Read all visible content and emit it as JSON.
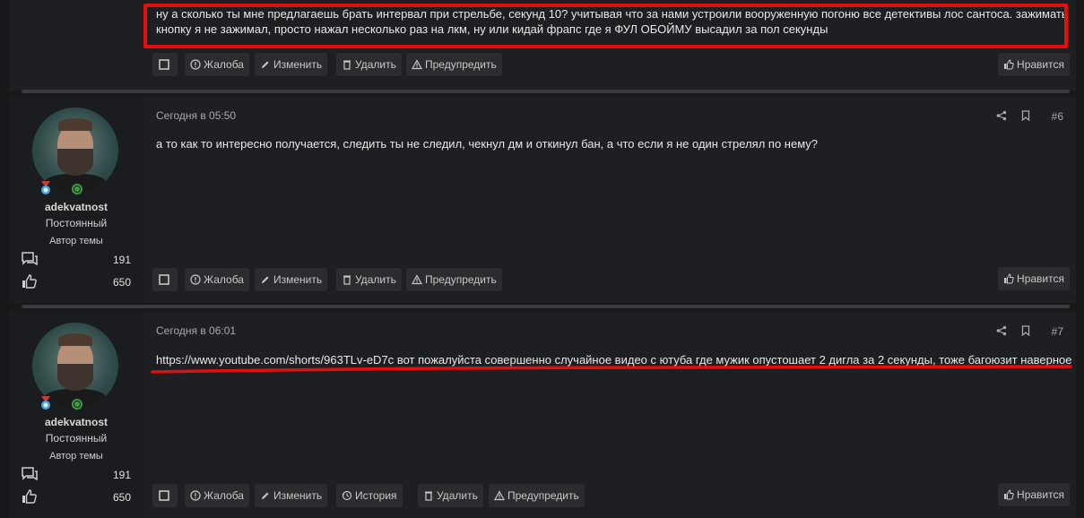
{
  "posts": [
    {
      "text": "ну а сколько ты мне предлагаешь брать интервал при стрельбе, секунд 10? учитывая что за нами устроили вооруженную погоню все детективы лос сантоса. зажимать кнопку я не зажимал, просто нажал несколько раз на лкм, ну или кидай фрапс где я ФУЛ ОБОЙМУ высадил за пол секунды",
      "actions": [
        "Жалоба",
        "Изменить",
        "Удалить",
        "Предупредить"
      ],
      "like": "Нравится"
    },
    {
      "author": {
        "name": "adekvatnost",
        "title": "Постоянный",
        "role": "Автор темы",
        "messages": "191",
        "reactions": "650"
      },
      "date": "Сегодня в 05:50",
      "number": "#6",
      "text": "а то как то интересно получается, следить ты не следил, чекнул дм и откинул бан, а что если я не один стрелял по нему?",
      "actions": [
        "Жалоба",
        "Изменить",
        "Удалить",
        "Предупредить"
      ],
      "like": "Нравится"
    },
    {
      "author": {
        "name": "adekvatnost",
        "title": "Постоянный",
        "role": "Автор темы",
        "messages": "191",
        "reactions": "650"
      },
      "date": "Сегодня в 06:01",
      "number": "#7",
      "link": "https://www.youtube.com/shorts/963TLv-eD7c",
      "text": "вот пожалуйста совершенно случайное видео с ютуба где мужик опустошает 2 дигла за 2 секунды, тоже багоюзит наверное",
      "actions": [
        "Жалоба",
        "Изменить",
        "История",
        "Удалить",
        "Предупредить"
      ],
      "like": "Нравится"
    }
  ],
  "colors": {
    "highlight": "#e60d0d",
    "online": "#3f9a3f",
    "background": "#17181a",
    "panel": "#1e1f22"
  },
  "icons": [
    "checkbox-icon",
    "report-icon",
    "edit-icon",
    "delete-icon",
    "warn-icon",
    "history-icon",
    "like-icon",
    "share-icon",
    "bookmark-icon",
    "messages-icon",
    "reactions-icon",
    "medal-icon"
  ]
}
